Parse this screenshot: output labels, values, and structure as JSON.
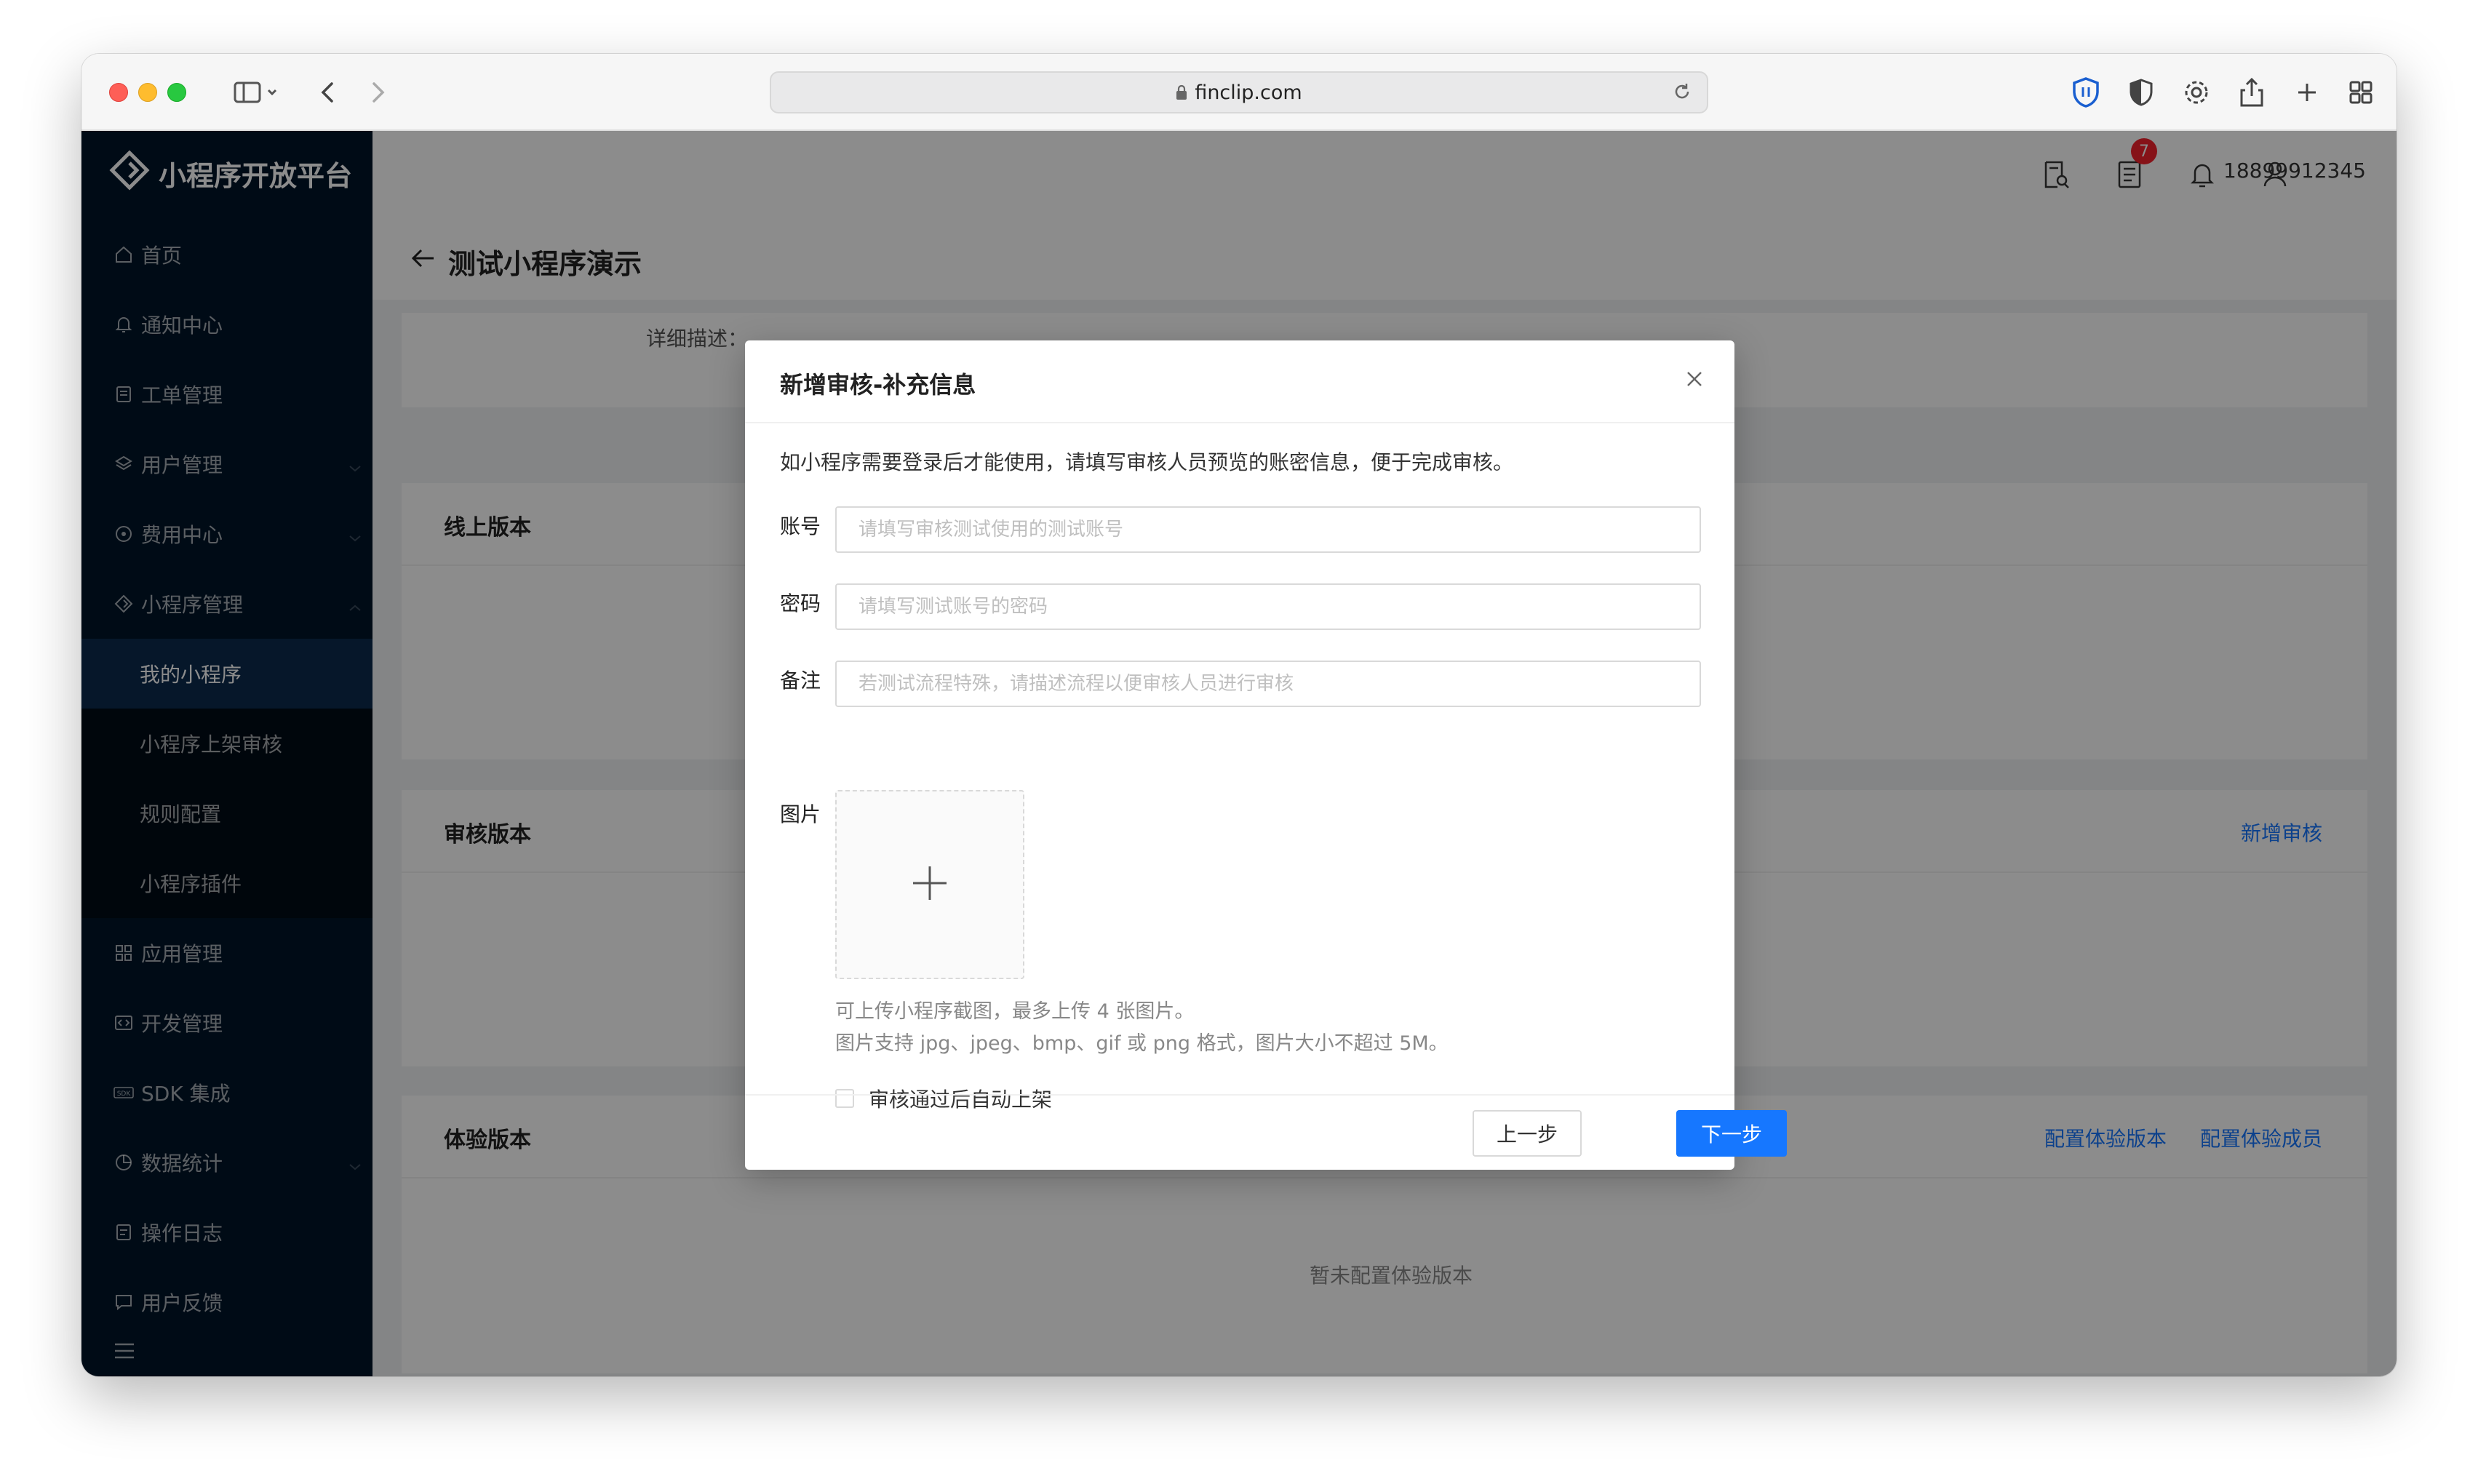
{
  "browser": {
    "url": "finclip.com"
  },
  "sidebar": {
    "brand": "小程序开放平台",
    "items": [
      {
        "label": "首页",
        "icon": "home-icon"
      },
      {
        "label": "通知中心",
        "icon": "bell-icon"
      },
      {
        "label": "工单管理",
        "icon": "ticket-icon"
      },
      {
        "label": "用户管理",
        "icon": "layers-icon"
      },
      {
        "label": "费用中心",
        "icon": "coin-icon"
      },
      {
        "label": "小程序管理",
        "icon": "diamond-icon"
      },
      {
        "label": "应用管理",
        "icon": "apps-icon"
      },
      {
        "label": "开发管理",
        "icon": "code-icon"
      },
      {
        "label": "SDK 集成",
        "icon": "sdk-icon"
      },
      {
        "label": "数据统计",
        "icon": "pie-icon"
      },
      {
        "label": "操作日志",
        "icon": "log-icon"
      },
      {
        "label": "用户反馈",
        "icon": "message-icon"
      }
    ],
    "subitems": [
      {
        "label": "我的小程序",
        "active": true
      },
      {
        "label": "小程序上架审核",
        "active": false
      },
      {
        "label": "规则配置",
        "active": false
      },
      {
        "label": "小程序插件",
        "active": false
      }
    ]
  },
  "topbar": {
    "notification_count": "7",
    "phone": "18899912345"
  },
  "page": {
    "title": "测试小程序演示",
    "desc_label": "详细描述：",
    "online_version": "线上版本",
    "review_version": "审核版本",
    "add_review": "新增审核",
    "trial_version": "体验版本",
    "config_trial_version": "配置体验版本",
    "config_trial_members": "配置体验成员",
    "trial_empty": "暂未配置体验版本"
  },
  "modal": {
    "title": "新增审核-补充信息",
    "intro": "如小程序需要登录后才能使用，请填写审核人员预览的账密信息，便于完成审核。",
    "account_label": "账号",
    "account_placeholder": "请填写审核测试使用的测试账号",
    "password_label": "密码",
    "password_placeholder": "请填写测试账号的密码",
    "remark_label": "备注",
    "remark_placeholder": "若测试流程特殊，请描述流程以便审核人员进行审核",
    "image_label": "图片",
    "upload_hint_1": "可上传小程序截图，最多上传 4 张图片。",
    "upload_hint_2": "图片支持 jpg、jpeg、bmp、gif 或 png 格式，图片大小不超过 5M。",
    "auto_publish_label": "审核通过后自动上架",
    "auto_publish_checked": false,
    "prev_button": "上一步",
    "next_button": "下一步"
  },
  "colors": {
    "sidebar_bg": "#001529",
    "sidebar_active": "#0c2a4d",
    "primary": "#1677ff",
    "badge": "#f5222d"
  }
}
